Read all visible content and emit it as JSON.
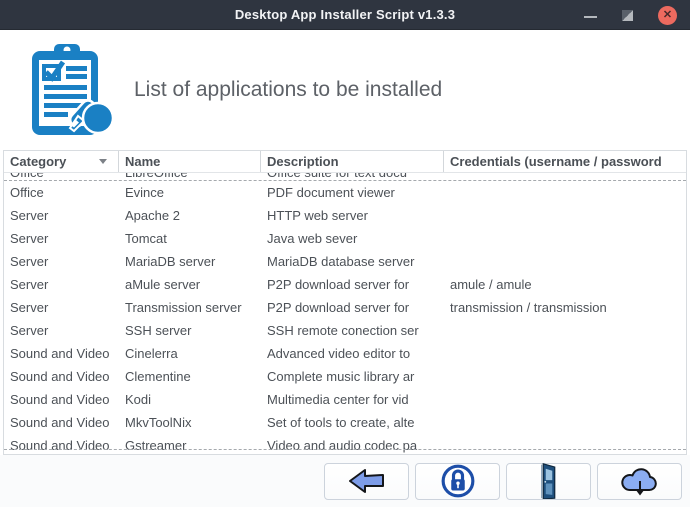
{
  "window": {
    "title": "Desktop App Installer Script v1.3.3",
    "controls": {
      "close_glyph": "✕"
    }
  },
  "header": {
    "title": "List of applications to be installed",
    "icon": "clipboard-checklist-icon"
  },
  "table": {
    "columns": [
      {
        "label": "Category",
        "sorted": true
      },
      {
        "label": "Name",
        "sorted": false
      },
      {
        "label": "Description",
        "sorted": false
      },
      {
        "label": "Credentials (username / password",
        "sorted": false
      }
    ],
    "rows": [
      {
        "category": "Office",
        "name": "LibreOffice",
        "description": "Office suite for text docu",
        "credentials": "",
        "partial": "top"
      },
      {
        "category": "Office",
        "name": "Evince",
        "description": "PDF document viewer",
        "credentials": ""
      },
      {
        "category": "Server",
        "name": "Apache 2",
        "description": "HTTP web server",
        "credentials": ""
      },
      {
        "category": "Server",
        "name": "Tomcat",
        "description": "Java web sever",
        "credentials": ""
      },
      {
        "category": "Server",
        "name": "MariaDB server",
        "description": "MariaDB database server",
        "credentials": ""
      },
      {
        "category": "Server",
        "name": "aMule server",
        "description": "P2P download server for",
        "credentials": "amule / amule"
      },
      {
        "category": "Server",
        "name": "Transmission server",
        "description": "P2P download server for",
        "credentials": "transmission / transmission"
      },
      {
        "category": "Server",
        "name": "SSH server",
        "description": "SSH remote conection ser",
        "credentials": ""
      },
      {
        "category": "Sound and Video",
        "name": "Cinelerra",
        "description": "Advanced video editor to",
        "credentials": ""
      },
      {
        "category": "Sound and Video",
        "name": "Clementine",
        "description": "Complete music library ar",
        "credentials": ""
      },
      {
        "category": "Sound and Video",
        "name": "Kodi",
        "description": "Multimedia center for vid",
        "credentials": ""
      },
      {
        "category": "Sound and Video",
        "name": "MkvToolNix",
        "description": "Set of tools to create, alte",
        "credentials": ""
      },
      {
        "category": "Sound and Video",
        "name": "Gstreamer",
        "description": "Video and audio codec pa",
        "credentials": "",
        "partial": "bottom"
      }
    ]
  },
  "toolbar": {
    "buttons": [
      {
        "name": "back",
        "icon": "back-arrow-icon"
      },
      {
        "name": "lock",
        "icon": "lock-icon"
      },
      {
        "name": "exit",
        "icon": "door-icon"
      },
      {
        "name": "download",
        "icon": "cloud-download-icon"
      }
    ]
  },
  "colors": {
    "titlebar": "#2f3540",
    "close_button": "#ec6a5f",
    "accent_blue": "#1a80c4",
    "button_icon_blue": "#7d9ce8",
    "lock_blue": "#1d4ea8",
    "text_gray": "#4c5157"
  }
}
